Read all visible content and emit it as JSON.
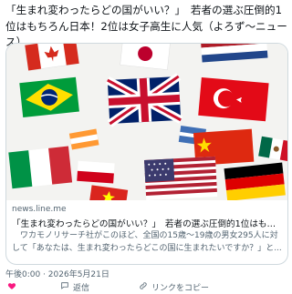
{
  "post": {
    "text": "「生まれ変わったらどの国がいい？」　若者の選ぶ圧倒的1位はもちろん日本！2位は女子高生に人気（よろず〜ニュース）"
  },
  "card": {
    "domain": "news.line.me",
    "title": "「生まれ変わったらどの国がいい？」　若者の選ぶ圧倒的1位はもちろん...",
    "desc_line1": "　ワカモノリサーチ社がこのほど、全国の15歳〜19歳の男女295人に対",
    "desc_line2": "して「あなたは、生まれ変わったらどこの国に生まれたいですか？」と..."
  },
  "meta": {
    "timestamp": "午後0:00 · 2026年5月21日"
  },
  "actions": {
    "like_icon": "heart-icon",
    "like_label": "",
    "reply_icon": "speech-bubble-icon",
    "reply_label": "返信",
    "copy_icon": "link-icon",
    "copy_label": "リンクをコピー"
  }
}
